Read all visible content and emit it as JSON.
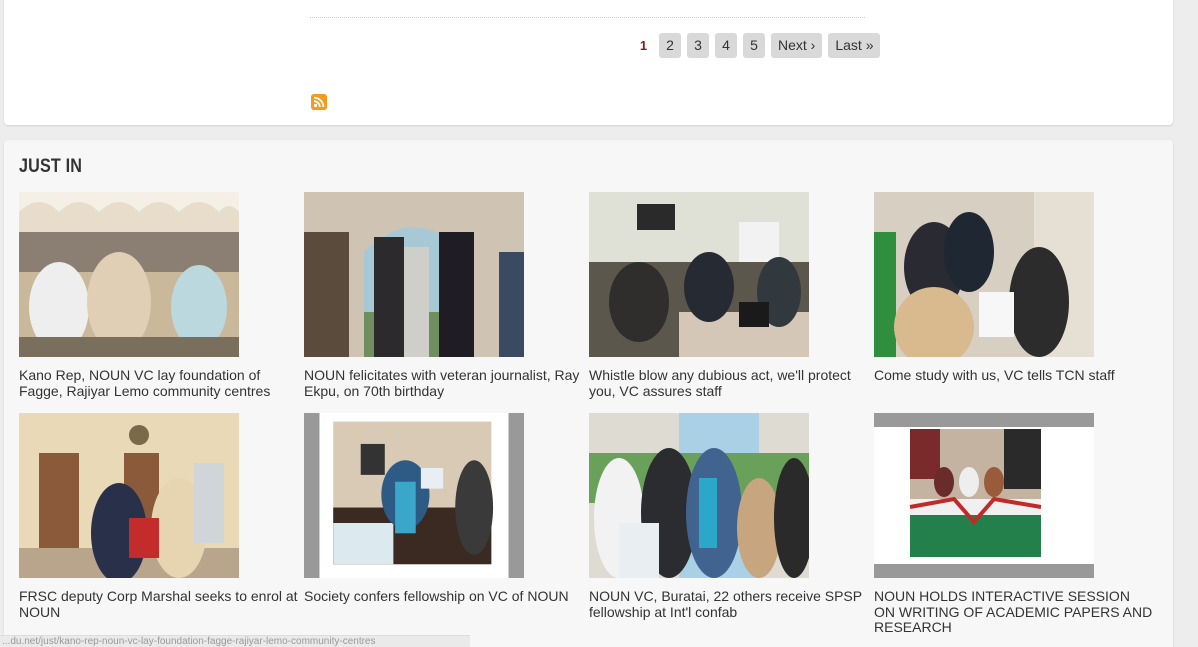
{
  "pagination": {
    "current": "1",
    "pages": [
      "2",
      "3",
      "4",
      "5"
    ],
    "next": "Next ›",
    "last": "Last »"
  },
  "section": {
    "title": "JUST IN"
  },
  "news": [
    {
      "title": "Kano Rep, NOUN VC lay foundation of Fagge, Rajiyar Lemo community centres"
    },
    {
      "title": "NOUN felicitates with veteran journalist, Ray Ekpu, on 70th birthday"
    },
    {
      "title": "Whistle blow any dubious act, we'll protect you, VC assures staff"
    },
    {
      "title": "Come study with us, VC tells TCN staff"
    },
    {
      "title": "FRSC deputy Corp Marshal seeks to enrol at NOUN"
    },
    {
      "title": "Society confers fellowship on VC of NOUN"
    },
    {
      "title": "NOUN VC, Buratai, 22 others receive SPSP fellowship at Int'l confab"
    },
    {
      "title": "NOUN HOLDS INTERACTIVE SESSION ON WRITING OF ACADEMIC PAPERS AND RESEARCH"
    }
  ],
  "status_url": "...du.net/just/kano-rep-noun-vc-lay-foundation-fagge-rajiyar-lemo-community-centres",
  "icons": {
    "rss": "rss-icon"
  }
}
